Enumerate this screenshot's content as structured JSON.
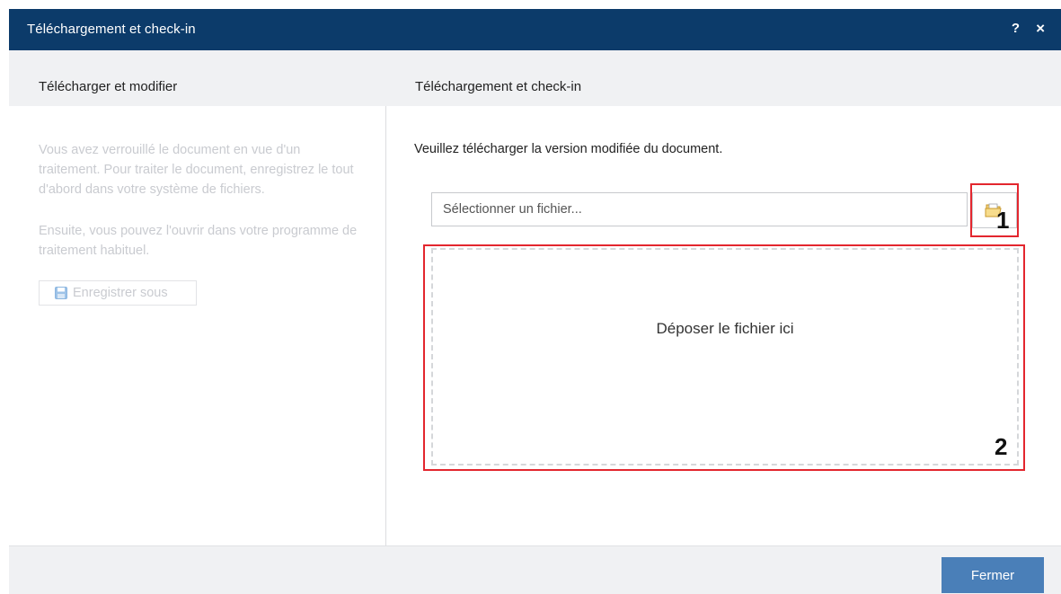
{
  "dialog": {
    "title": "Téléchargement et check-in",
    "help_label": "?",
    "close_icon_label": "×"
  },
  "left_panel": {
    "heading": "Télécharger et modifier",
    "info_paragraph_1": "Vous avez verrouillé le document en vue d'un traitement. Pour traiter le document, enregistrez le tout d'abord dans votre système de fichiers.",
    "info_paragraph_2": "Ensuite, vous pouvez l'ouvrir dans votre programme de traitement habituel.",
    "save_as_label": "Enregistrer sous",
    "save_icon": "floppy-disk-icon"
  },
  "right_panel": {
    "heading": "Téléchargement et check-in",
    "instruction": "Veuillez télécharger la version modifiée du document.",
    "file_input_placeholder": "Sélectionner un fichier...",
    "browse_icon": "open-folder-icon",
    "dropzone_label": "Déposer le fichier ici"
  },
  "annotations": {
    "marker_1": "1",
    "marker_2": "2",
    "highlight_color": "#e3262e"
  },
  "footer": {
    "close_button_label": "Fermer"
  },
  "colors": {
    "titlebar": "#0c3b6a",
    "primary_button": "#4a7fb8",
    "disabled_text": "#c9cbd0"
  }
}
